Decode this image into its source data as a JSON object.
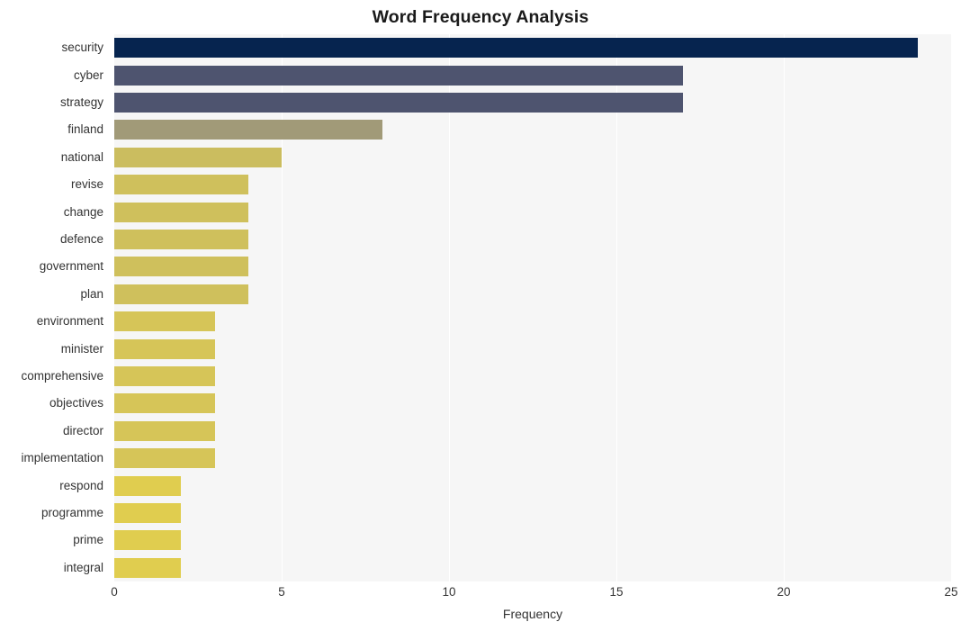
{
  "chart_data": {
    "type": "bar",
    "orientation": "horizontal",
    "title": "Word Frequency Analysis",
    "xlabel": "Frequency",
    "ylabel": "",
    "categories": [
      "security",
      "cyber",
      "strategy",
      "finland",
      "national",
      "revise",
      "change",
      "defence",
      "government",
      "plan",
      "environment",
      "minister",
      "comprehensive",
      "objectives",
      "director",
      "implementation",
      "respond",
      "programme",
      "prime",
      "integral"
    ],
    "values": [
      24,
      17,
      17,
      8,
      5,
      4,
      4,
      4,
      4,
      4,
      3,
      3,
      3,
      3,
      3,
      3,
      2,
      2,
      2,
      2
    ],
    "bar_colors": [
      "#06244f",
      "#4e546f",
      "#4e546f",
      "#a19a78",
      "#cbbd5f",
      "#cfc05c",
      "#cfc05c",
      "#cfc05c",
      "#cfc05c",
      "#cfc05c",
      "#d6c558",
      "#d6c558",
      "#d6c558",
      "#d6c558",
      "#d6c558",
      "#d6c558",
      "#e0cd4f",
      "#e0cd4f",
      "#e0cd4f",
      "#e0cd4f"
    ],
    "xlim": [
      0,
      25
    ],
    "xticks": [
      0,
      5,
      10,
      15,
      20,
      25
    ],
    "xtick_labels": [
      "0",
      "5",
      "10",
      "15",
      "20",
      "25"
    ],
    "grid": true,
    "grid_axis": "x",
    "legend": null,
    "plot_background": "#f6f6f6",
    "figure_background": "#ffffff"
  }
}
